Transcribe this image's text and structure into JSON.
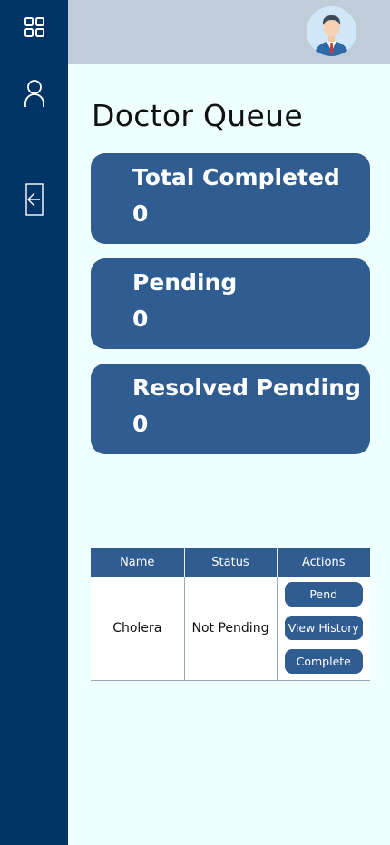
{
  "sidebar": {
    "items": [
      {
        "icon": "grid-icon"
      },
      {
        "icon": "user-icon"
      },
      {
        "icon": "logout-arrow-icon"
      }
    ]
  },
  "header": {
    "avatar_icon": "doctor-avatar-icon"
  },
  "page": {
    "title": "Doctor Queue"
  },
  "stats": [
    {
      "label": "Total Completed",
      "value": "0"
    },
    {
      "label": "Pending",
      "value": "0"
    },
    {
      "label": "Resolved Pending",
      "value": "0"
    }
  ],
  "table": {
    "headers": [
      "Name",
      "Status",
      "Actions"
    ],
    "rows": [
      {
        "name": "Cholera",
        "status": "Not Pending",
        "actions": [
          "Pend",
          "View History",
          "Complete"
        ]
      }
    ]
  },
  "colors": {
    "sidebar": "#003366",
    "topbar": "#c0cdd8",
    "accent": "#2f5d91",
    "background": "#eefffd"
  }
}
